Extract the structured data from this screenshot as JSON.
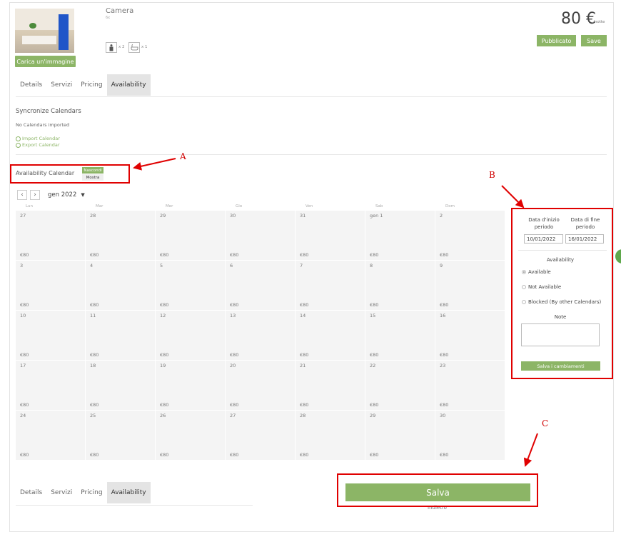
{
  "header": {
    "room_title": "Camera",
    "room_subtitle": "6x",
    "guests_count": "x 2",
    "bath_count": "x 1",
    "upload_label": "Carica un'immagine",
    "price": "80 €",
    "price_unit": "/notte",
    "published_label": "Pubblicato",
    "save_label": "Save"
  },
  "tabs": [
    "Details",
    "Servizi",
    "Pricing",
    "Availability"
  ],
  "sync": {
    "title": "Syncronize Calendars",
    "status": "No Calendars imported",
    "import_label": "Import Calendar",
    "export_label": "Export Calendar"
  },
  "availability_calendar": {
    "label": "Availability Calendar",
    "toggle_hide": "Nascondi",
    "toggle_show": "Mostra"
  },
  "calendar": {
    "month_label": "gen 2022",
    "weekdays": [
      "Lun",
      "Mar",
      "Mer",
      "Gio",
      "Ven",
      "Sab",
      "Dom"
    ],
    "weeks": [
      [
        "27",
        "28",
        "29",
        "30",
        "31",
        "gen 1",
        "2"
      ],
      [
        "3",
        "4",
        "5",
        "6",
        "7",
        "8",
        "9"
      ],
      [
        "10",
        "11",
        "12",
        "13",
        "14",
        "15",
        "16"
      ],
      [
        "17",
        "18",
        "19",
        "20",
        "21",
        "22",
        "23"
      ],
      [
        "24",
        "25",
        "26",
        "27",
        "28",
        "29",
        "30"
      ]
    ],
    "price_label": "€80"
  },
  "side_panel": {
    "start_label": "Data d'inizio periodo",
    "end_label": "Data di fine periodo",
    "start_value": "10/01/2022",
    "end_value": "16/01/2022",
    "availability_title": "Availability",
    "options": [
      "Available",
      "Not Available",
      "Blocked (By other Calendars)"
    ],
    "selected_option": "Available",
    "note_label": "Note",
    "save_changes_label": "Salva i cambiamenti"
  },
  "footer": {
    "save_label": "Salva",
    "back_label": "Indietro"
  },
  "annotations": {
    "a": "A",
    "b": "B",
    "c": "C"
  }
}
